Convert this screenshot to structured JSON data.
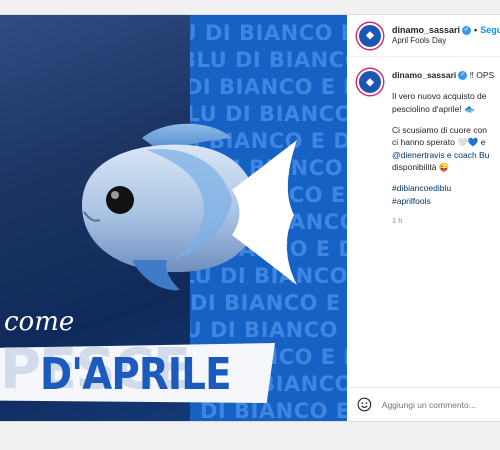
{
  "post": {
    "username": "dinamo_sassari",
    "verified_icon": "verified-badge-icon",
    "separator": "•",
    "follow_label": "Segu",
    "location": "April Fools Day",
    "image": {
      "stripe_text": "BLU DI BIANCO E DI BLU DI BIANCO",
      "come_text": "come",
      "pesce_text": "PESCE",
      "daprile_text": "D'APRILE"
    },
    "caption": {
      "username": "dinamo_sassari",
      "badge": "‼ OPS",
      "line1": "Il vero nuovo acquisto de",
      "line2": "pesciolino d'aprile! 🐟",
      "line3": "Ci scusiamo di cuore con",
      "line4": "ci hanno sperato 🤍💙 e",
      "line5": "@dienertravis e coach Bu",
      "line6": "disponibilità 😜",
      "tag1": "#dibiancoediblu",
      "tag2": "#aprilfools",
      "time": "1 h"
    },
    "add_comment_placeholder": "Aggiungi un commento..."
  }
}
